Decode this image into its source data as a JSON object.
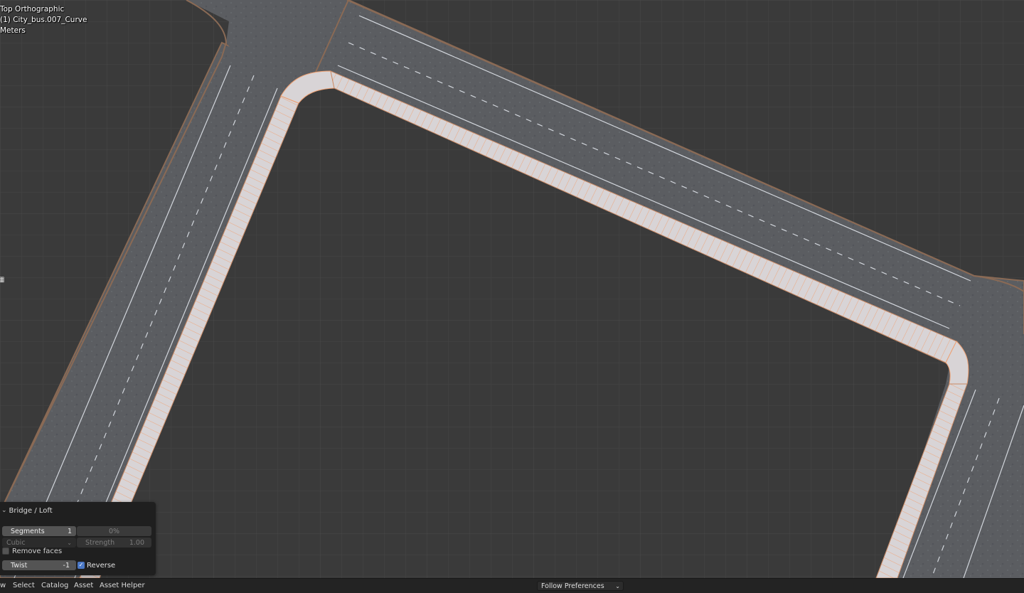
{
  "viewport": {
    "view_name": "Top Orthographic",
    "active_object": "(1) City_bus.007_Curve",
    "units": "Meters",
    "colors": {
      "background": "#3a3a3a",
      "road": "#5b5d61",
      "road_edge": "#8a6a55",
      "sidewalk": "#d8d4d6",
      "sidewalk_lines": "#f1a070",
      "lane_marking": "#d2d6dc"
    }
  },
  "operator_panel": {
    "title": "Bridge / Loft",
    "segments_label": "Segments",
    "segments_value": "1",
    "smoothness_value": "0%",
    "interpolation_value": "Cubic",
    "strength_label": "Strength",
    "strength_value": "1.00",
    "remove_faces_label": "Remove faces",
    "remove_faces_checked": false,
    "twist_label": "Twist",
    "twist_value": "-1",
    "reverse_label": "Reverse",
    "reverse_checked": true
  },
  "menubar": {
    "items": [
      "w",
      "Select",
      "Catalog",
      "Asset",
      "Asset Helper"
    ],
    "library_select": "Follow Preferences"
  }
}
